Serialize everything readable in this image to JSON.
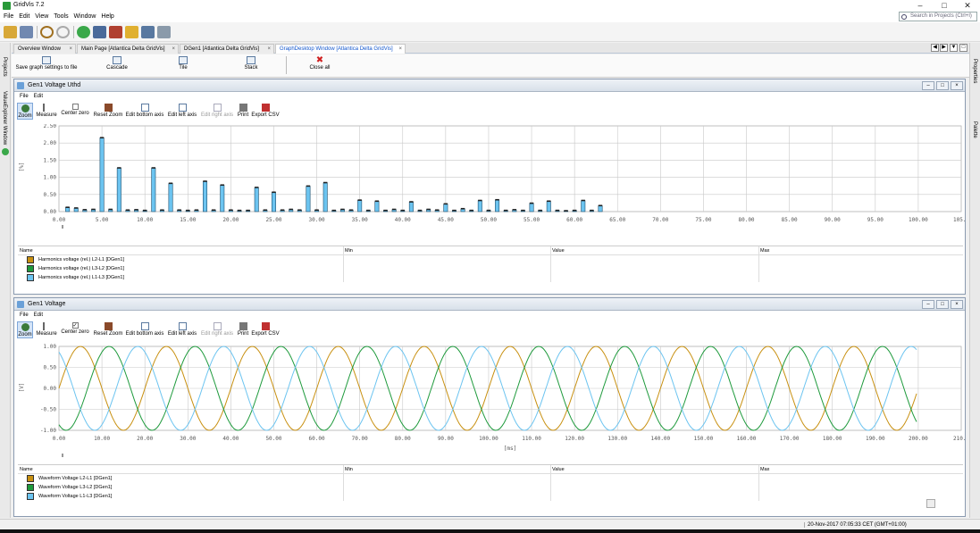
{
  "app": {
    "title": "GridVis 7.2",
    "search_placeholder": "Search in Projects (Ctrl+I)"
  },
  "menu": [
    "File",
    "Edit",
    "View",
    "Tools",
    "Window",
    "Help"
  ],
  "tabs": [
    {
      "label": "Overview Window",
      "active": false
    },
    {
      "label": "Main Page [Atlantica Delta GridVis]",
      "active": false
    },
    {
      "label": "DGen1 [Atlantica Delta GridVis]",
      "active": false
    },
    {
      "label": "GraphDesktop Window [Atlantica Delta GridVis]",
      "active": true
    }
  ],
  "sidebar_left": [
    "Projects",
    "ValueExplorer Window"
  ],
  "sidebar_right": [
    "Properties",
    "Palette"
  ],
  "actions": [
    {
      "label": "Save graph settings to file",
      "icon": "save-settings-icon"
    },
    {
      "label": "Cascade",
      "icon": "cascade-icon"
    },
    {
      "label": "Tile",
      "icon": "tile-icon"
    },
    {
      "label": "Stack",
      "icon": "stack-icon"
    },
    {
      "label": "Close all",
      "icon": "close-all-icon"
    }
  ],
  "graph_tools": [
    {
      "label": "Zoom",
      "icon": "zoom-icon",
      "state": "selected"
    },
    {
      "label": "Measure",
      "icon": "measure-icon",
      "state": "normal"
    },
    {
      "label": "Center zero",
      "icon": "checkbox-icon",
      "state": "normal"
    },
    {
      "label": "Reset Zoom",
      "icon": "reset-zoom-icon",
      "state": "normal"
    },
    {
      "label": "Edit bottom axis",
      "icon": "edit-axis-icon",
      "state": "normal"
    },
    {
      "label": "Edit left axis",
      "icon": "edit-axis-icon",
      "state": "normal"
    },
    {
      "label": "Edit right axis",
      "icon": "edit-axis-icon",
      "state": "disabled"
    },
    {
      "label": "Print",
      "icon": "print-icon",
      "state": "normal"
    },
    {
      "label": "Export CSV",
      "icon": "export-csv-icon",
      "state": "normal"
    }
  ],
  "panel_menu": [
    "File",
    "Edit"
  ],
  "legend_columns": [
    "Name",
    "Min",
    "Value",
    "Max"
  ],
  "panels": [
    {
      "title": "Gen1 Voltage Uthd",
      "legend": [
        {
          "name": "Harmonics voltage (rel.) L2-L1 [DGen1]",
          "color": "#c89010"
        },
        {
          "name": "Harmonics voltage (rel.) L3-L2 [DGen1]",
          "color": "#1e9a3c"
        },
        {
          "name": "Harmonics voltage (rel.) L1-L3 [DGen1]",
          "color": "#6cc4f0"
        }
      ]
    },
    {
      "title": "Gen1 Voltage",
      "legend": [
        {
          "name": "Waveform Voltage L2-L1 [DGen1]",
          "color": "#c89010"
        },
        {
          "name": "Waveform Voltage L3-L2 [DGen1]",
          "color": "#1e9a3c"
        },
        {
          "name": "Waveform Voltage L1-L3 [DGen1]",
          "color": "#6cc4f0"
        }
      ]
    }
  ],
  "status": {
    "datetime": "20-Nov-2017 07:05:33 CET (GMT+01:00)"
  },
  "chart_data": [
    {
      "type": "bar",
      "ylabel": "[%]",
      "xlim": [
        0,
        100
      ],
      "ylim": [
        0,
        2.5
      ],
      "xticks": [
        "0.00",
        "5.00",
        "10.00",
        "15.00",
        "20.00",
        "25.00",
        "30.00",
        "35.00",
        "40.00",
        "45.00",
        "50.00",
        "55.00",
        "60.00",
        "65.00",
        "70.00",
        "75.00",
        "80.00",
        "85.00",
        "90.00",
        "95.00",
        "100.00",
        "105.0"
      ],
      "yticks": [
        "0.00",
        "0.50",
        "1.00",
        "1.50",
        "2.00",
        "2.50"
      ],
      "x": [
        1,
        2,
        3,
        4,
        5,
        6,
        7,
        8,
        9,
        10,
        11,
        12,
        13,
        14,
        15,
        16,
        17,
        18,
        19,
        20,
        21,
        22,
        23,
        24,
        25,
        26,
        27,
        28,
        29,
        30,
        31,
        32,
        33,
        34,
        35,
        36,
        37,
        38,
        39,
        40,
        41,
        42,
        43,
        44,
        45,
        46,
        47,
        48,
        49,
        50,
        51,
        52,
        53,
        54,
        55,
        56,
        57,
        58,
        59,
        60,
        61,
        62,
        63
      ],
      "values": [
        0.12,
        0.1,
        0.05,
        0.06,
        2.15,
        0.06,
        1.27,
        0.04,
        0.05,
        0.03,
        1.27,
        0.04,
        0.82,
        0.04,
        0.03,
        0.04,
        0.88,
        0.04,
        0.77,
        0.04,
        0.03,
        0.03,
        0.7,
        0.04,
        0.56,
        0.04,
        0.06,
        0.04,
        0.74,
        0.04,
        0.84,
        0.03,
        0.06,
        0.04,
        0.33,
        0.03,
        0.3,
        0.03,
        0.06,
        0.03,
        0.28,
        0.03,
        0.06,
        0.04,
        0.22,
        0.03,
        0.08,
        0.03,
        0.32,
        0.03,
        0.34,
        0.03,
        0.05,
        0.03,
        0.24,
        0.03,
        0.3,
        0.03,
        0.02,
        0.03,
        0.32,
        0.03,
        0.17
      ]
    },
    {
      "type": "line",
      "xlabel": "[ms]",
      "ylabel": "[V]",
      "xlim": [
        0,
        210
      ],
      "ylim": [
        -1.0,
        1.0
      ],
      "xticks": [
        "0.00",
        "10.00",
        "20.00",
        "30.00",
        "40.00",
        "50.00",
        "60.00",
        "70.00",
        "80.00",
        "90.00",
        "100.00",
        "110.00",
        "120.00",
        "130.00",
        "140.00",
        "150.00",
        "160.00",
        "170.00",
        "180.00",
        "190.00",
        "200.00",
        "210.0"
      ],
      "yticks": [
        "1.00",
        "0.50",
        "0.00",
        "-0.50",
        "-1.00"
      ],
      "series": [
        {
          "name": "Waveform Voltage L2-L1 [DGen1]",
          "color": "#c89010",
          "amplitude": 1.0,
          "frequency_hz": 50,
          "phase_deg": 0
        },
        {
          "name": "Waveform Voltage L3-L2 [DGen1]",
          "color": "#1e9a3c",
          "amplitude": 1.0,
          "frequency_hz": 50,
          "phase_deg": -120
        },
        {
          "name": "Waveform Voltage L1-L3 [DGen1]",
          "color": "#6cc4f0",
          "amplitude": 1.0,
          "frequency_hz": 50,
          "phase_deg": 120
        }
      ],
      "x_end": 200
    }
  ]
}
